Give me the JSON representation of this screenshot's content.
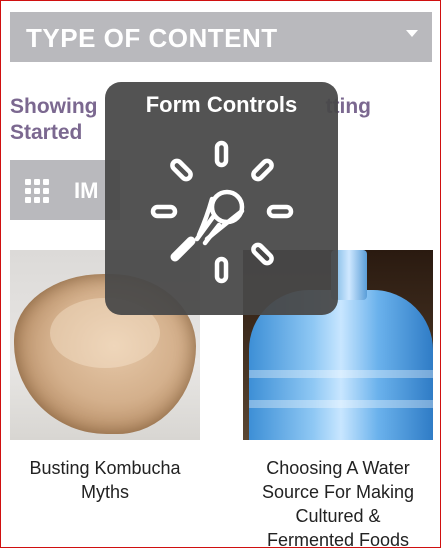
{
  "filter": {
    "label": "TYPE OF CONTENT",
    "caret_icon": "chevron-down-icon"
  },
  "listing": {
    "showing_prefix": "Showing",
    "showing_suffix": "tting",
    "showing_line2": "Started"
  },
  "view_toggle": {
    "icon": "grid-icon",
    "label_partial": "IM"
  },
  "articles": [
    {
      "title_line1": "Busting Kombucha",
      "title_line2": "Myths"
    },
    {
      "title_line1": "Choosing A Water",
      "title_line2": "Source For Making",
      "title_line3": "Cultured &",
      "title_line4": "Fermented Foods"
    }
  ],
  "hud": {
    "title": "Form Controls",
    "icon": "pointer-burst-icon"
  },
  "colors": {
    "bar_gray": "#b9b9bd",
    "heading_purple": "#7b6890",
    "hud_bg": "#484848",
    "frame_red": "#d01010"
  }
}
